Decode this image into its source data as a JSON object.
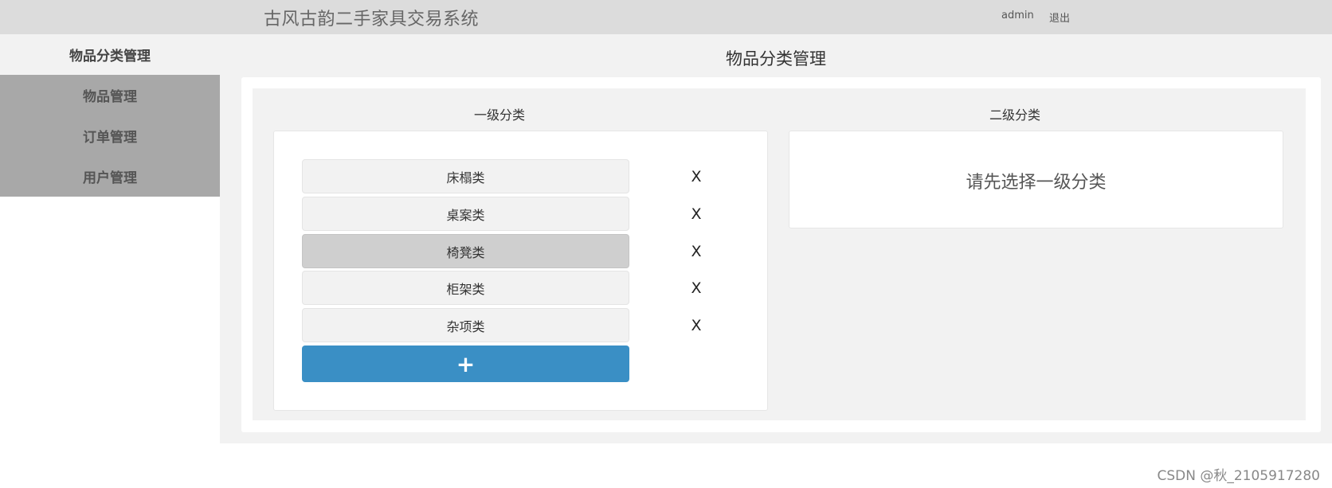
{
  "header": {
    "app_title": "古风古韵二手家具交易系统",
    "user_name": "admin",
    "logout_label": "退出"
  },
  "sidebar": {
    "active_label": "物品分类管理",
    "items": [
      {
        "label": "物品管理"
      },
      {
        "label": "订单管理"
      },
      {
        "label": "用户管理"
      }
    ]
  },
  "main": {
    "page_title": "物品分类管理",
    "level1": {
      "title": "一级分类",
      "categories": [
        {
          "label": "床榻类",
          "delete_label": "X"
        },
        {
          "label": "桌案类",
          "delete_label": "X"
        },
        {
          "label": "椅凳类",
          "delete_label": "X",
          "selected": true
        },
        {
          "label": "柜架类",
          "delete_label": "X"
        },
        {
          "label": "杂项类",
          "delete_label": "X"
        }
      ],
      "add_label": "+"
    },
    "level2": {
      "title": "二级分类",
      "hint": "请先选择一级分类"
    }
  },
  "watermark": "CSDN @秋_2105917280"
}
